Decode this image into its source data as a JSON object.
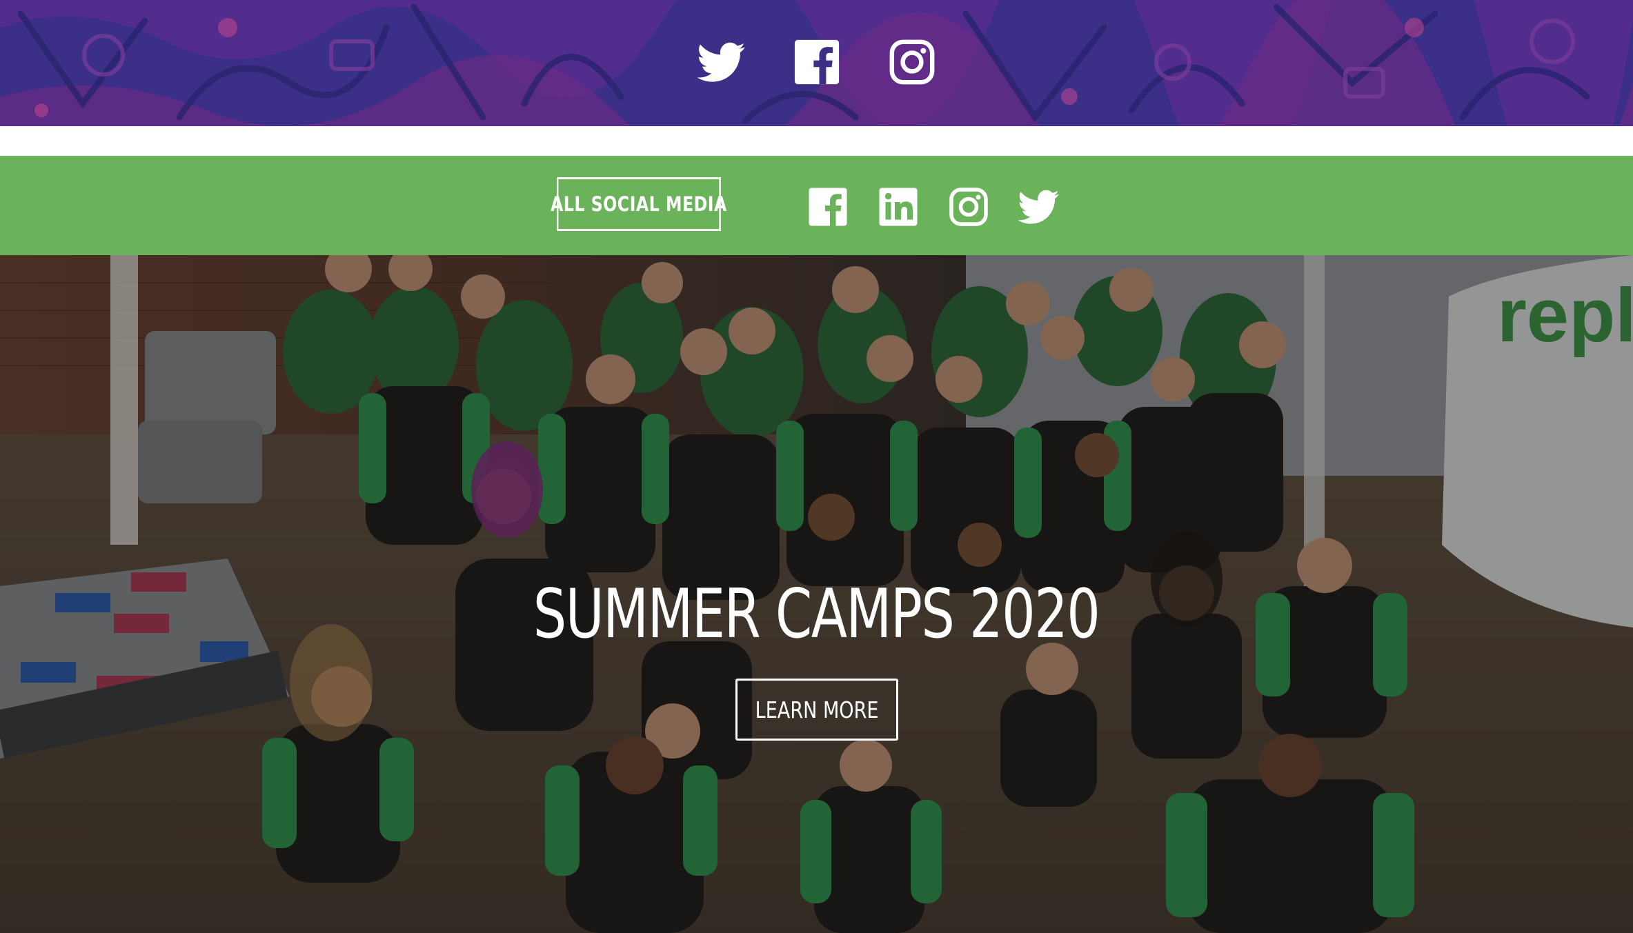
{
  "header": {
    "social_icons": [
      "twitter-icon",
      "facebook-icon",
      "instagram-icon"
    ],
    "background_color": "#3d2f86"
  },
  "social_bar": {
    "button_label": "ALL SOCIAL MEDIA",
    "icons": [
      "facebook-icon",
      "linkedin-icon",
      "instagram-icon",
      "twitter-icon"
    ],
    "background_color": "#6ab35a"
  },
  "hero": {
    "title": "SUMMER CAMPS 2020",
    "cta_label": "LEARN MORE"
  },
  "colors": {
    "purple": "#3d2f86",
    "green": "#6ab35a",
    "white": "#ffffff"
  }
}
